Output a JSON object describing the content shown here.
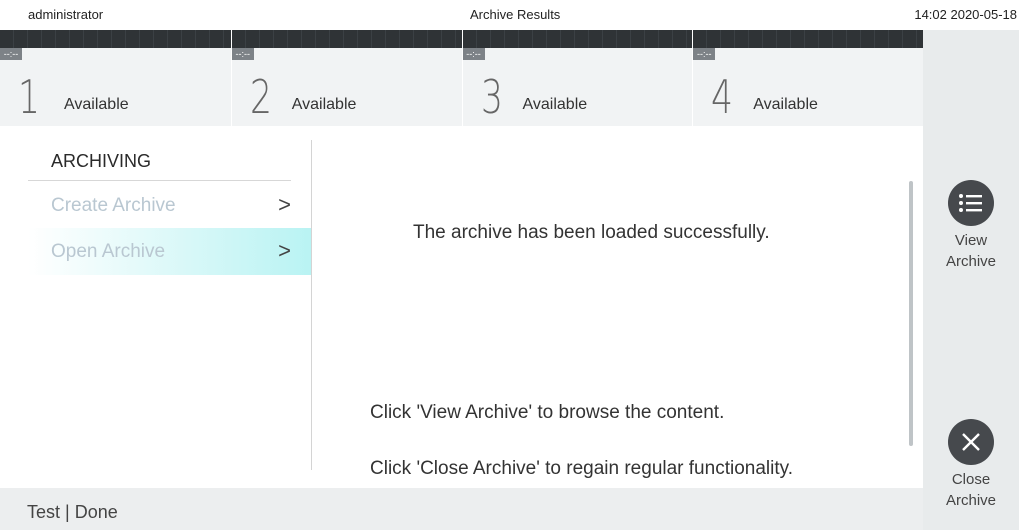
{
  "topbar": {
    "user": "administrator",
    "title": "Archive Results",
    "clock": "14:02 2020-05-18"
  },
  "modules": [
    {
      "timer": "--:--",
      "number": "1",
      "status": "Available"
    },
    {
      "timer": "--:--",
      "number": "2",
      "status": "Available"
    },
    {
      "timer": "--:--",
      "number": "3",
      "status": "Available"
    },
    {
      "timer": "--:--",
      "number": "4",
      "status": "Available"
    }
  ],
  "menu": {
    "section": "ARCHIVING",
    "items": [
      {
        "label": "Create Archive",
        "chevron": ">"
      },
      {
        "label": "Open Archive",
        "chevron": ">"
      }
    ]
  },
  "content": {
    "message": "The archive has been loaded successfully.",
    "hint_view": "Click 'View Archive' to browse the content.",
    "hint_close": "Click 'Close Archive' to regain regular functionality."
  },
  "actions": {
    "view": "View Archive",
    "close": "Close Archive"
  },
  "footer": {
    "text": "Test | Done"
  },
  "colors": {
    "accent": "#b9f3f3",
    "dark": "#46494d",
    "panel": "#e8ebec"
  }
}
